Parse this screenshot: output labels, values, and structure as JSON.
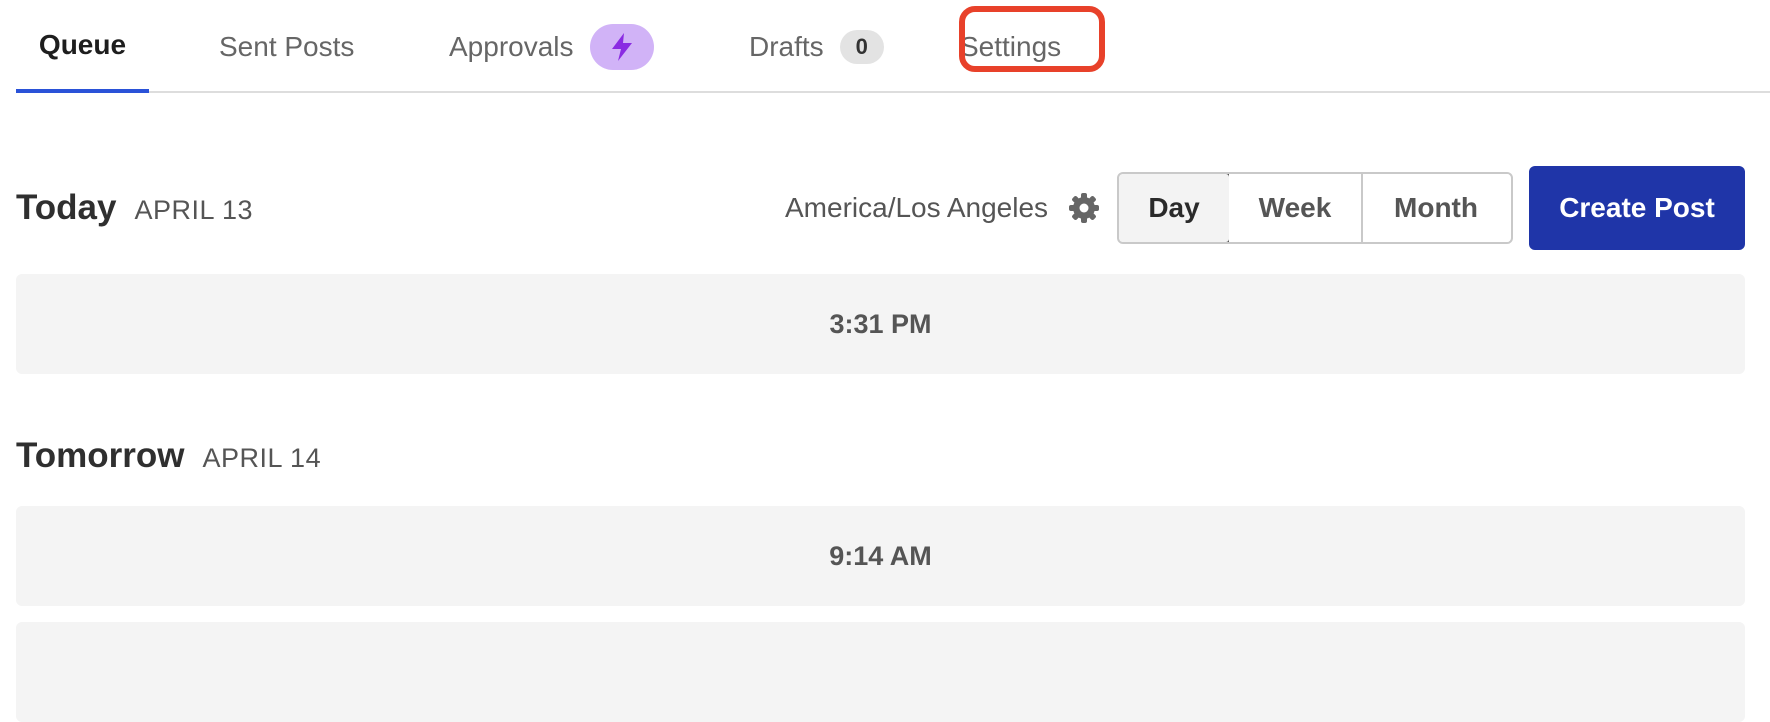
{
  "tabs": {
    "queue": "Queue",
    "sent": "Sent Posts",
    "approvals": "Approvals",
    "drafts": "Drafts",
    "drafts_count": "0",
    "settings": "Settings"
  },
  "colors": {
    "accent": "#2a52d8",
    "primary_button": "#1f35a8",
    "highlight": "#e8412a",
    "approvals_badge": "#d1b3f7"
  },
  "controls": {
    "timezone": "America/Los Angeles",
    "views": [
      "Day",
      "Week",
      "Month"
    ],
    "selected_view": "Day",
    "create_post": "Create Post"
  },
  "days": [
    {
      "title": "Today",
      "date": "APRIL 13",
      "slots": [
        "3:31 PM"
      ]
    },
    {
      "title": "Tomorrow",
      "date": "APRIL 14",
      "slots": [
        "9:14 AM",
        ""
      ]
    }
  ]
}
